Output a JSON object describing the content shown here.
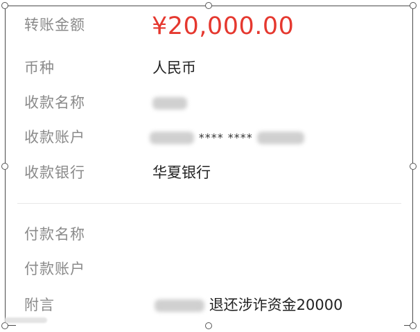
{
  "transfer": {
    "amount_label": "转账金额",
    "amount_value": "¥20,000.00",
    "currency_label": "币种",
    "currency_value": "人民币",
    "payee_name_label": "收款名称",
    "payee_account_label": "收款账户",
    "payee_account_masked": "**** ****",
    "payee_bank_label": "收款银行",
    "payee_bank_value": "华夏银行",
    "payer_name_label": "付款名称",
    "payer_account_label": "付款账户",
    "memo_label": "附言",
    "memo_value": "退还涉诈资金20000"
  },
  "colors": {
    "amount": "#e5382f",
    "label": "#8a8a8a",
    "value": "#222222"
  }
}
